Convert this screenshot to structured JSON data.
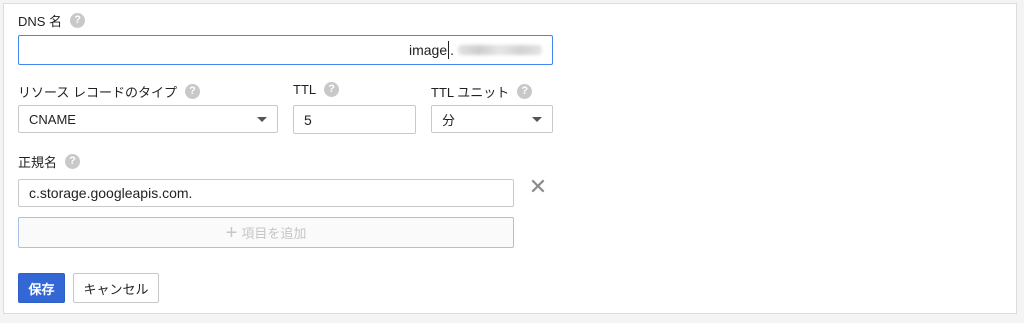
{
  "dns_name": {
    "label": "DNS 名",
    "value": "image",
    "suffix_redacted": true
  },
  "record_type": {
    "label": "リソース レコードのタイプ",
    "selected": "CNAME"
  },
  "ttl": {
    "label": "TTL",
    "value": "5"
  },
  "ttl_unit": {
    "label": "TTL ユニット",
    "selected": "分"
  },
  "canonical_name": {
    "label": "正規名",
    "value": "c.storage.googleapis.com."
  },
  "add_item": {
    "label": "項目を追加",
    "icon": "plus-icon"
  },
  "actions": {
    "save_label": "保存",
    "cancel_label": "キャンセル"
  },
  "icons": {
    "help": "help-icon",
    "remove": "close-icon",
    "dropdown": "chevron-down-icon"
  },
  "colors": {
    "primary": "#3367d6",
    "focus_border": "#4285f4"
  }
}
